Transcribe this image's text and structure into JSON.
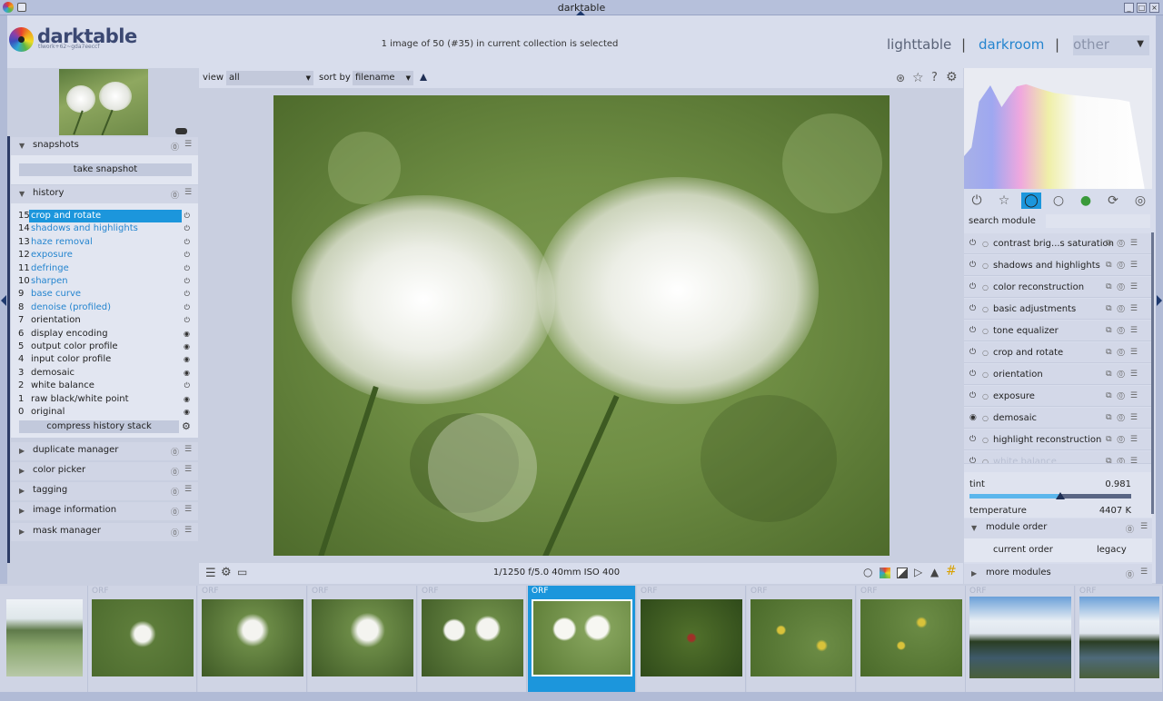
{
  "window": {
    "title": "darktable"
  },
  "header": {
    "app_name": "darktable",
    "version": "tlwork+62~gda7eeccf",
    "status": "1 image of 50 (#35) in current collection is selected",
    "views": [
      "lighttable",
      "darkroom",
      "other"
    ],
    "separator": "|",
    "active_view": "darkroom"
  },
  "left": {
    "snapshots": {
      "title": "snapshots",
      "button": "take snapshot"
    },
    "history": {
      "title": "history",
      "items": [
        {
          "n": "15",
          "label": "crop and rotate",
          "state": "on",
          "style": "selected"
        },
        {
          "n": "14",
          "label": "shadows and highlights",
          "state": "on",
          "style": "changed"
        },
        {
          "n": "13",
          "label": "haze removal",
          "state": "on",
          "style": "changed"
        },
        {
          "n": "12",
          "label": "exposure",
          "state": "on",
          "style": "changed"
        },
        {
          "n": "11",
          "label": "defringe",
          "state": "on",
          "style": "changed"
        },
        {
          "n": "10",
          "label": "sharpen",
          "state": "on",
          "style": "changed"
        },
        {
          "n": "9",
          "label": "base curve",
          "state": "on",
          "style": "changed"
        },
        {
          "n": "8",
          "label": "denoise (profiled)",
          "state": "on",
          "style": "changed"
        },
        {
          "n": "7",
          "label": "orientation",
          "state": "on",
          "style": "default"
        },
        {
          "n": "6",
          "label": "display encoding",
          "state": "always",
          "style": "default"
        },
        {
          "n": "5",
          "label": "output color profile",
          "state": "always",
          "style": "default"
        },
        {
          "n": "4",
          "label": "input color profile",
          "state": "always",
          "style": "default"
        },
        {
          "n": "3",
          "label": "demosaic",
          "state": "always",
          "style": "default"
        },
        {
          "n": "2",
          "label": "white balance",
          "state": "on",
          "style": "default"
        },
        {
          "n": "1",
          "label": "raw black/white point",
          "state": "always",
          "style": "default"
        },
        {
          "n": "0",
          "label": "original",
          "state": "always",
          "style": "default"
        }
      ],
      "compress_button": "compress history stack"
    },
    "modules": [
      "duplicate manager",
      "color picker",
      "tagging",
      "image information",
      "mask manager"
    ]
  },
  "toolbar": {
    "view_label": "view",
    "view_value": "all",
    "sort_label": "sort by",
    "sort_value": "filename"
  },
  "bottom_bar": {
    "exif": "1/1250 f/5.0 40mm ISO 400"
  },
  "right": {
    "search_label": "search module",
    "modules": [
      {
        "name": "contrast brig...s saturation",
        "power": "on"
      },
      {
        "name": "shadows and highlights",
        "power": "on"
      },
      {
        "name": "color reconstruction",
        "power": "on"
      },
      {
        "name": "basic adjustments",
        "power": "on"
      },
      {
        "name": "tone equalizer",
        "power": "on"
      },
      {
        "name": "crop and rotate",
        "power": "on"
      },
      {
        "name": "orientation",
        "power": "on"
      },
      {
        "name": "exposure",
        "power": "on"
      },
      {
        "name": "demosaic",
        "power": "always"
      },
      {
        "name": "highlight reconstruction",
        "power": "on"
      },
      {
        "name": "white balance",
        "power": "on"
      }
    ],
    "wb": {
      "tint_label": "tint",
      "tint_value": "0.981",
      "temp_label": "temperature",
      "temp_value": "4407 K",
      "tint_level": 0.56
    },
    "module_order": {
      "title": "module order",
      "current_label": "current order",
      "current_value": "legacy"
    },
    "more_modules": "more modules"
  },
  "filmstrip": {
    "labels": [
      "",
      "ORF",
      "ORF",
      "ORF",
      "ORF",
      "ORF",
      "ORF",
      "ORF",
      "ORF",
      "ORF",
      "ORF"
    ],
    "selected_index": 5
  },
  "colors": {
    "accent": "#1c96dc",
    "panel": "#c9cfe0",
    "header": "#d8ddec"
  }
}
